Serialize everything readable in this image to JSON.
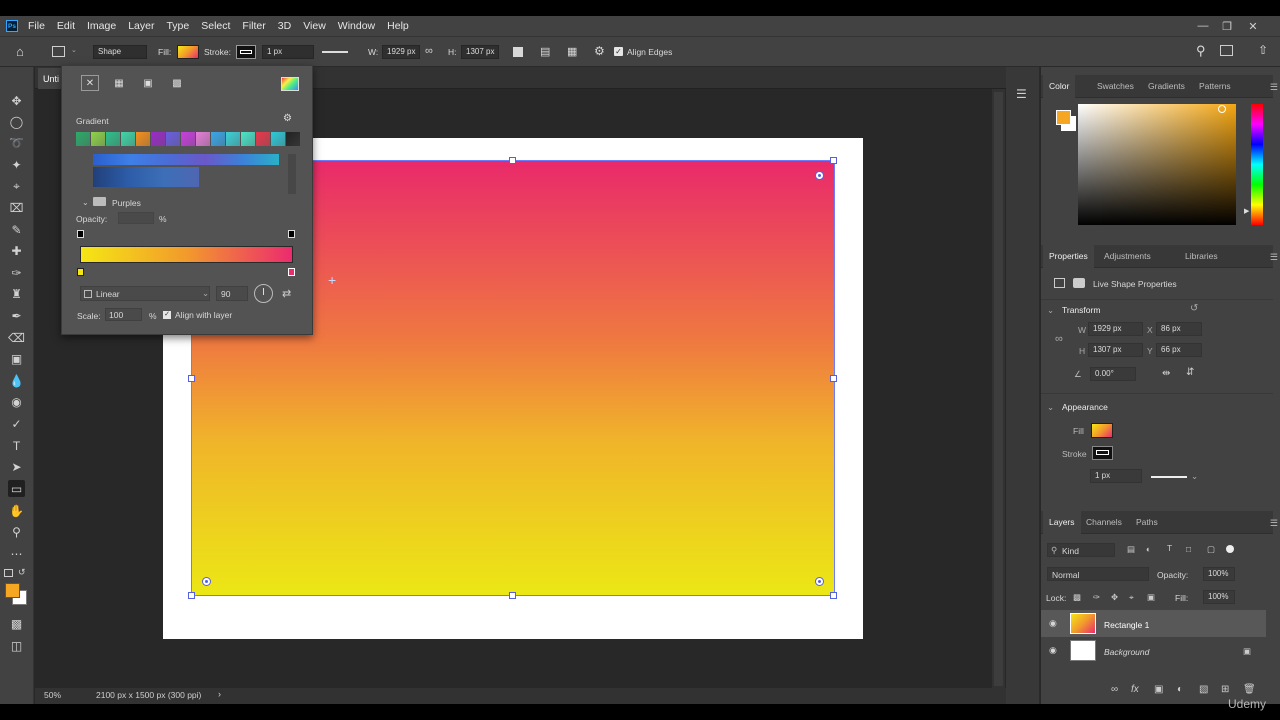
{
  "app": {
    "logo": "Ps"
  },
  "menu": [
    "File",
    "Edit",
    "Image",
    "Layer",
    "Type",
    "Select",
    "Filter",
    "3D",
    "View",
    "Window",
    "Help"
  ],
  "options_bar": {
    "mode": "Shape",
    "fill_label": "Fill:",
    "stroke_label": "Stroke:",
    "stroke_width": "1 px",
    "w_label": "W:",
    "w_value": "1929 px",
    "h_label": "H:",
    "h_value": "1307 px",
    "align_edges": "Align Edges"
  },
  "document": {
    "tab_title": "Unti",
    "zoom": "50%",
    "info": "2100 px x 1500 px (300 ppi)"
  },
  "fill_popup": {
    "section_title": "Gradient",
    "folder_name": "Purples",
    "opacity_label": "Opacity:",
    "opacity_unit": "%",
    "gradient_type": "Linear",
    "angle": "90",
    "scale_label": "Scale:",
    "scale_value": "100",
    "scale_unit": "%",
    "align_with_layer": "Align with layer",
    "preset_colors": [
      "#2ea96b",
      "#8ed34a",
      "#2fbf8c",
      "#3ed6a8",
      "#f5901e",
      "#9b2bc9",
      "#6b5fe0",
      "#c93fe0",
      "#e47fd7",
      "#3aa6e8",
      "#3dd0d6",
      "#4ae4c9",
      "#e8384d",
      "#2ec8d8",
      "#222222"
    ]
  },
  "color_panel": {
    "tabs": [
      "Color",
      "Swatches",
      "Gradients",
      "Patterns"
    ],
    "foreground_color": "#f5a623",
    "background_color": "#ffffff"
  },
  "properties_panel": {
    "tabs": [
      "Properties",
      "Adjustments",
      "Libraries"
    ],
    "subtitle": "Live Shape Properties",
    "transform_title": "Transform",
    "w_label": "W",
    "w_value": "1929 px",
    "x_label": "X",
    "x_value": "86 px",
    "h_label": "H",
    "h_value": "1307 px",
    "y_label": "Y",
    "y_value": "66 px",
    "angle": "0.00°",
    "appearance_title": "Appearance",
    "fill_label": "Fill",
    "stroke_label": "Stroke",
    "stroke_width": "1 px"
  },
  "layers_panel": {
    "tabs": [
      "Layers",
      "Channels",
      "Paths"
    ],
    "filter_kind": "Kind",
    "blend_mode": "Normal",
    "opacity_label": "Opacity:",
    "opacity_value": "100%",
    "lock_label": "Lock:",
    "fill_label": "Fill:",
    "fill_value": "100%",
    "layers": [
      {
        "name": "Rectangle 1",
        "selected": true
      },
      {
        "name": "Background",
        "selected": false
      }
    ]
  },
  "watermark": "Udemy"
}
